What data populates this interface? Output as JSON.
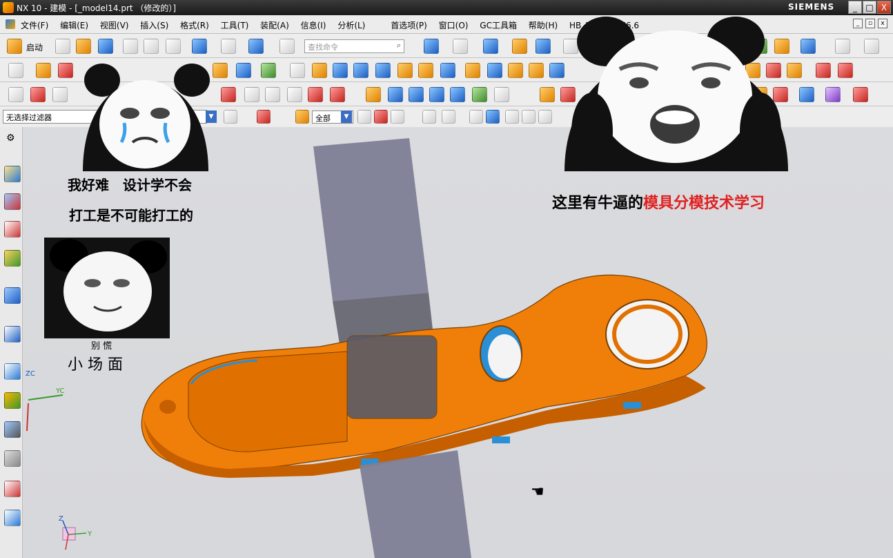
{
  "window": {
    "title": "NX 10 - 建模 - [_model14.prt （修改的）]",
    "brand": "SIEMENS",
    "controls": [
      "_",
      "□",
      "X"
    ]
  },
  "menubar": {
    "items": [
      "文件(F)",
      "编辑(E)",
      "视图(V)",
      "插入(S)",
      "格式(R)",
      "工具(T)",
      "装配(A)",
      "信息(I)",
      "分析(L)"
    ],
    "items_right": [
      "首选项(P)",
      "窗口(O)",
      "GC工具箱",
      "帮助(H)",
      "HB_MOULD M6.6"
    ]
  },
  "toolbar": {
    "start_label": "启动",
    "search_placeholder": "查找命令"
  },
  "selection_bar": {
    "filter_value": "无选择过滤器",
    "scope_value": "全部"
  },
  "viewport": {
    "axis_labels": {
      "zc": "ZC",
      "yc": "YC",
      "triad_z": "Z",
      "triad_y": "Y"
    }
  },
  "overlays": {
    "meme_left_top_line1": "我好难　设计学不会",
    "meme_left_top_line2": "打工是不可能打工的",
    "meme_left_bottom_small": "别 慌",
    "meme_left_bottom_big": "小 场 面",
    "meme_right_black": "这里有牛逼的",
    "meme_right_red": "模具分模技术学习"
  },
  "colors": {
    "part_orange": "#f07f0a",
    "part_shadow": "#c55f00",
    "inner_blue": "#2a8fd4",
    "box_gray": "#7e8096",
    "accent_red": "#e02020"
  }
}
